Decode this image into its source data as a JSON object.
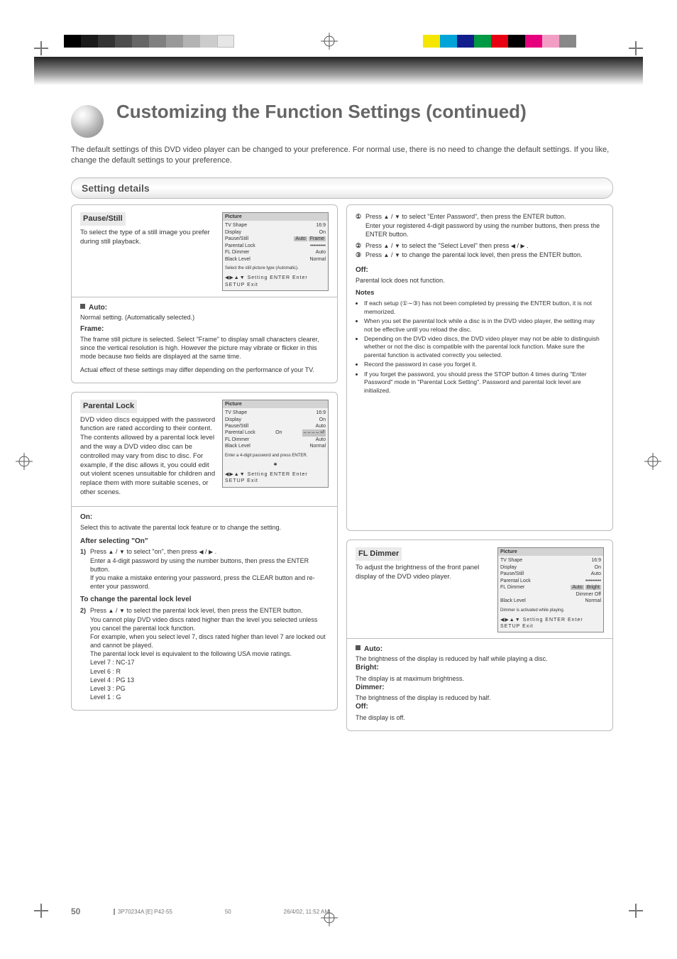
{
  "page": {
    "title": "Customizing the Function Settings (continued)",
    "subtitle": "The default settings of this DVD video player can be changed to your preference. For normal use, there is no need to change the default settings. If you like, change the default settings to your preference.",
    "banner": "Setting details",
    "page_number": "50"
  },
  "footer": {
    "left": "3P70234A [E] P42-55",
    "center": "50",
    "right": "26/4/02, 11:52 AM"
  },
  "panelA": {
    "title": "Pause/Still",
    "desc": "To select the type of a still image you prefer during still playback.",
    "osd": {
      "title": "Picture",
      "rows": [
        {
          "label": "TV Shape",
          "value": "16:9"
        },
        {
          "label": "Display",
          "value": "On"
        },
        {
          "label": "Pause/Still",
          "value": "Auto",
          "options": [
            "Auto",
            "Frame"
          ]
        },
        {
          "label": "Parental Lock",
          "value": "•••••••••"
        },
        {
          "label": "FL Dimmer",
          "value": "Auto"
        },
        {
          "label": "Black Level",
          "value": "Normal"
        }
      ],
      "help": "Select the still picture type (Automatic).",
      "arrows": "◀▶▲▼  Setting        ENTER  Enter  SETUP  Exit"
    },
    "auto": {
      "h": "Auto:",
      "t": "Normal setting. (Automatically selected.)"
    },
    "frame": {
      "h": "Frame:",
      "t": "The frame still picture is selected. Select \"Frame\" to display small characters clearer, since the vertical resolution is high. However the picture may vibrate or flicker in this mode because two fields are displayed at the same time."
    },
    "note": "Actual effect of these settings may differ depending on the performance of your TV."
  },
  "panelB": {
    "title": "Parental Lock",
    "desc": "DVD video discs equipped with the password function are rated according to their content. The contents allowed by a parental lock level and the way a DVD video disc can be controlled may vary from disc to disc. For example, if the disc allows it, you could edit out violent scenes unsuitable for children and replace them with more suitable scenes, or other scenes.",
    "osd": {
      "title": "Picture",
      "rows": [
        {
          "label": "TV Shape",
          "value": "16:9"
        },
        {
          "label": "Display",
          "value": "On"
        },
        {
          "label": "Pause/Still",
          "value": "Auto"
        },
        {
          "label": "Parental Lock",
          "value": "On",
          "options": [
            "– – – – ⏎"
          ]
        },
        {
          "label": "FL Dimmer",
          "value": "Auto"
        },
        {
          "label": "Black Level",
          "value": "Normal"
        }
      ],
      "help1": "Enter a 4-digit password and press ENTER.",
      "help2": "✱",
      "arrows": "◀▶▲▼  Setting        ENTER  Enter  SETUP  Exit"
    },
    "onH": "On:",
    "onT": "Select this to activate the parental lock feature or to change the setting.",
    "s1_h": "After selecting \"On\"",
    "s1": "1) Press / to select \"on\", then press / .",
    "s1b": "Enter a 4-digit password by using the number buttons, then press the ENTER button.",
    "s1c": "If you make a mistake entering your password, press the CLEAR button and re-enter your password.",
    "s2_h": "To change the parental lock level",
    "s2a": "2) Press / to select the parental lock level, then press the ENTER button.",
    "s2b": "You cannot play DVD video discs rated higher than the level you selected unless you cancel the parental lock function.",
    "s2c": "For example, when you select level 7, discs rated higher than level 7 are locked out and cannot be played.",
    "s2d": "The parental lock level is equivalent to the following USA movie ratings.",
    "levels": [
      {
        "l": "Level 7 :",
        "v": "NC-17"
      },
      {
        "l": "Level 6 :",
        "v": "R"
      },
      {
        "l": "Level 4 :",
        "v": "PG 13"
      },
      {
        "l": "Level 3 :",
        "v": "PG"
      },
      {
        "l": "Level 1 :",
        "v": "G"
      }
    ]
  },
  "panelC": {
    "c1": "Press / to select \"Enter Password\", then press the ENTER button.",
    "c2": "Enter your registered 4-digit password by using the number buttons, then press the ENTER button.",
    "c3": "Press / to select the \"Select Level\" then press / .",
    "c4": "Press / to change the parental lock level, then press the ENTER button.",
    "off_h": "Off:",
    "off_t": "Parental lock does not function.",
    "notes_h": "Notes",
    "notes": [
      "If each setup (①∼③) has not been completed by pressing the ENTER button, it is not memorized.",
      "When you set the parental lock while a disc is in the DVD video player, the setting may not be effective until you reload the disc.",
      "Depending on the DVD video discs, the DVD video player may not be able to distinguish whether or not the disc is compatible with the parental lock function. Make sure the parental function is activated correctly you selected.",
      "Record the password in case you forget it.",
      "If you forget the password, you should press the STOP button 4 times during \"Enter Password\" mode in \"Parental Lock Setting\". Password and parental lock level are initialized."
    ]
  },
  "panelD": {
    "title": "FL Dimmer",
    "desc": "To adjust the brightness of the front panel display of the DVD video player.",
    "osd": {
      "title": "Picture",
      "rows": [
        {
          "label": "TV Shape",
          "value": "16:9"
        },
        {
          "label": "Display",
          "value": "On"
        },
        {
          "label": "Pause/Still",
          "value": "Auto"
        },
        {
          "label": "Parental Lock",
          "value": "•••••••••"
        },
        {
          "label": "FL Dimmer",
          "value": "Auto",
          "options": [
            "Auto",
            "Bright",
            "Dimmer",
            "Off"
          ]
        },
        {
          "label": "Black Level",
          "value": "Normal"
        }
      ],
      "help": "Dimmer is activated while playing.",
      "arrows": "◀▶▲▼  Setting        ENTER  Enter  SETUP  Exit"
    },
    "auto": {
      "h": "Auto:",
      "t": "The brightness of the display is reduced by half while playing a disc."
    },
    "bright": {
      "h": "Bright:",
      "t": "The display is at maximum brightness."
    },
    "dimmer": {
      "h": "Dimmer:",
      "t": "The brightness of the display is reduced by half."
    },
    "off": {
      "h": "Off:",
      "t": "The display is off."
    }
  },
  "icons": {
    "tri_up": "▲",
    "tri_down": "▼",
    "tri_left": "◀",
    "tri_right": "▶"
  }
}
